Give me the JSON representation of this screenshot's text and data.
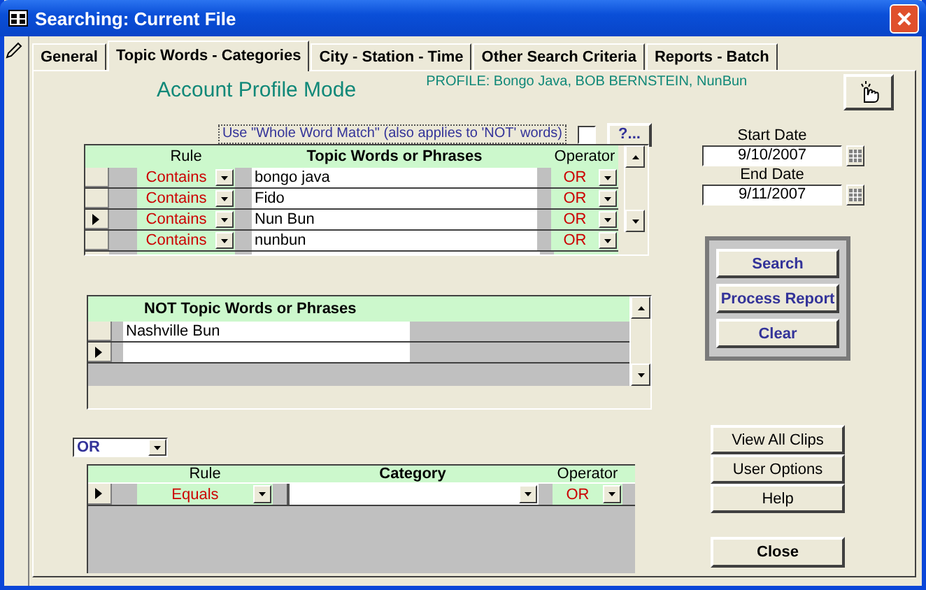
{
  "window": {
    "title": "Searching: Current File"
  },
  "tabs": [
    {
      "label": "General",
      "selected": false
    },
    {
      "label": "Topic Words -  Categories",
      "selected": true
    },
    {
      "label": "City - Station - Time",
      "selected": false
    },
    {
      "label": "Other Search Criteria",
      "selected": false
    },
    {
      "label": "Reports - Batch",
      "selected": false
    }
  ],
  "mode_title": "Account Profile Mode",
  "profile": "PROFILE:  Bongo Java, BOB BERNSTEIN, NunBun",
  "whole_word": {
    "label": "Use \"Whole Word Match\"  (also applies to 'NOT' words)",
    "checked": false,
    "help_button": "?..."
  },
  "topic_grid": {
    "columns": [
      "Rule",
      "Topic Words or Phrases",
      "Operator"
    ],
    "rows": [
      {
        "rule": "Contains",
        "phrase": "bongo java",
        "operator": "OR",
        "current": false
      },
      {
        "rule": "Contains",
        "phrase": "Fido",
        "operator": "OR",
        "current": false
      },
      {
        "rule": "Contains",
        "phrase": "Nun Bun",
        "operator": "OR",
        "current": true
      },
      {
        "rule": "Contains",
        "phrase": "nunbun",
        "operator": "OR",
        "current": false
      }
    ]
  },
  "not_grid": {
    "column": "NOT Topic Words or Phrases",
    "rows": [
      {
        "phrase": "Nashville Bun",
        "current": false
      },
      {
        "current": true
      }
    ]
  },
  "join_operator": "OR",
  "category_grid": {
    "columns": [
      "Rule",
      "Category",
      "Operator"
    ],
    "rows": [
      {
        "rule": "Equals",
        "operator": "OR",
        "current": true
      }
    ]
  },
  "start_date": {
    "label": "Start Date",
    "value": "9/10/2007"
  },
  "end_date": {
    "label": "End Date",
    "value": "9/11/2007"
  },
  "actions": [
    "Search",
    "Process Report",
    "Clear"
  ],
  "buttons": [
    "View All Clips",
    "User Options",
    "Help"
  ],
  "close_button": "Close"
}
